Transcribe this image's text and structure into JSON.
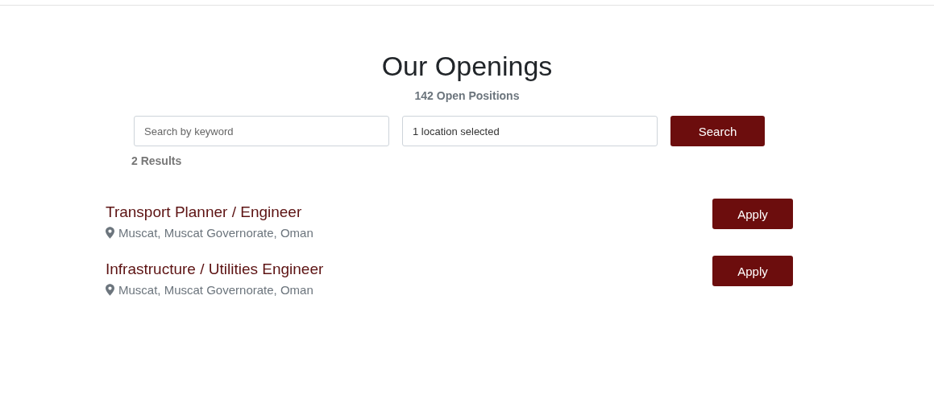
{
  "title": "Our Openings",
  "subtitle": "142 Open Positions",
  "search": {
    "keyword_placeholder": "Search by keyword",
    "location_value": "1 location selected",
    "button": "Search"
  },
  "results_count": "2 Results",
  "jobs": [
    {
      "title": "Transport Planner / Engineer",
      "location": "Muscat, Muscat Governorate, Oman",
      "button": "Apply"
    },
    {
      "title": "Infrastructure / Utilities Engineer",
      "location": "Muscat, Muscat Governorate, Oman",
      "button": "Apply"
    }
  ]
}
